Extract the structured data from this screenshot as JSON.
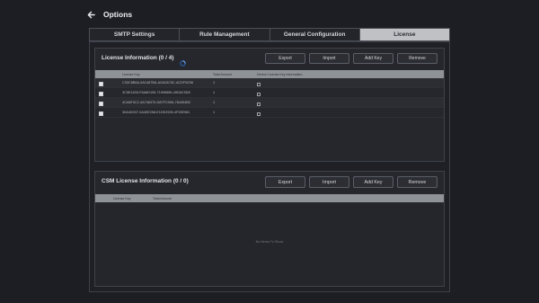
{
  "header": {
    "title": "Options"
  },
  "tabs": [
    {
      "label": "SMTP Settings",
      "active": false
    },
    {
      "label": "Rule Management",
      "active": false
    },
    {
      "label": "General Configuration",
      "active": false
    },
    {
      "label": "License",
      "active": true
    }
  ],
  "license_panel": {
    "title": "License Information (0 / 4)",
    "buttons": {
      "export": "Export",
      "import": "Import",
      "add_key": "Add Key",
      "remove": "Remove"
    },
    "columns": {
      "license_key": "License Key",
      "total_amount": "Total Amount",
      "device": "Device License Key Information"
    },
    "rows": [
      {
        "key": "C33C8B6A-5A1467BA-A0A03C5C-ACDF5Z06",
        "amount": "1"
      },
      {
        "key": "3C5E1633-F6A6D195-71996585-49D6C9D8",
        "amount": "1"
      },
      {
        "key": "4CA6F0C2-4A746375-D87FC59A-784454B2",
        "amount": "1"
      },
      {
        "key": "30A4D037-0A40E258-E1DE2935-4F33E981",
        "amount": "1"
      }
    ]
  },
  "csm_panel": {
    "title": "CSM License Information (0 / 0)",
    "buttons": {
      "export": "Export",
      "import": "Import",
      "add_key": "Add Key",
      "remove": "Remove"
    },
    "columns": {
      "license_key": "License Key",
      "total_amount": "Total Amount"
    },
    "empty_message": "No Items To Show"
  },
  "colors": {
    "active_tab": "#bfc1c5",
    "accent": "#3a7bd5",
    "background": "#1c1e23"
  }
}
